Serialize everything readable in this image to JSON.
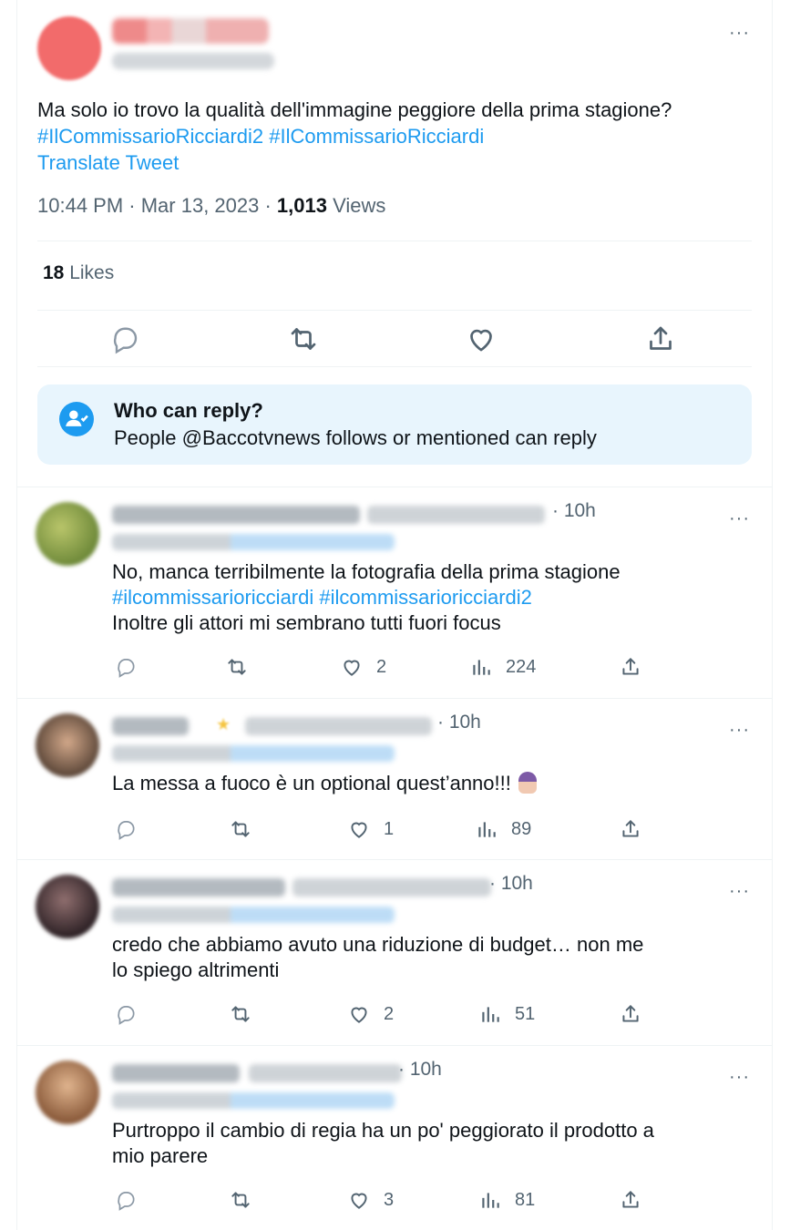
{
  "main_tweet": {
    "more_label": "···",
    "text_before": "Ma solo io trovo la qualità dell'immagine peggiore della prima stagione?",
    "hashtag_1": "#IlCommissarioRicciardi2",
    "hashtag_2": "#IlCommissarioRicciardi",
    "translate_label": "Translate Tweet",
    "timestamp": "10:44 PM · Mar 13, 2023 ·",
    "views_count": "1,013",
    "views_label": "Views",
    "likes_count": "18",
    "likes_label": "Likes",
    "actions": [
      "reply-icon",
      "retweet-icon",
      "like-icon",
      "share-icon"
    ]
  },
  "who_can_reply": {
    "title": "Who can reply?",
    "subtitle": "People @Baccotvnews follows or mentioned can reply"
  },
  "replies": [
    {
      "time": "· 10h",
      "lines": [
        "No, manca terribilmente la fotografia della prima stagione"
      ],
      "hashtags": [
        "#ilcommissarioricciardi",
        "#ilcommissarioricciardi2"
      ],
      "line_after": "Inoltre gli attori mi sembrano tutti fuori focus",
      "likes": "2",
      "views": "224"
    },
    {
      "time": "· 10h",
      "text": "La messa a fuoco è un optional quest’anno!!!",
      "likes": "1",
      "views": "89"
    },
    {
      "time": "· 10h",
      "text_line_1": "credo che abbiamo avuto una riduzione di budget… non me",
      "text_line_2": "lo spiego altrimenti",
      "likes": "2",
      "views": "51"
    },
    {
      "time": "· 10h",
      "text_line_1": "Purtroppo il cambio di regia ha un po' peggiorato il prodotto a",
      "text_line_2": "mio parere",
      "likes": "3",
      "views": "81"
    }
  ],
  "colors": {
    "accent": "#1d9bf0",
    "muted": "#536471",
    "text": "#0f1419",
    "info_box": "#e8f5fd"
  }
}
